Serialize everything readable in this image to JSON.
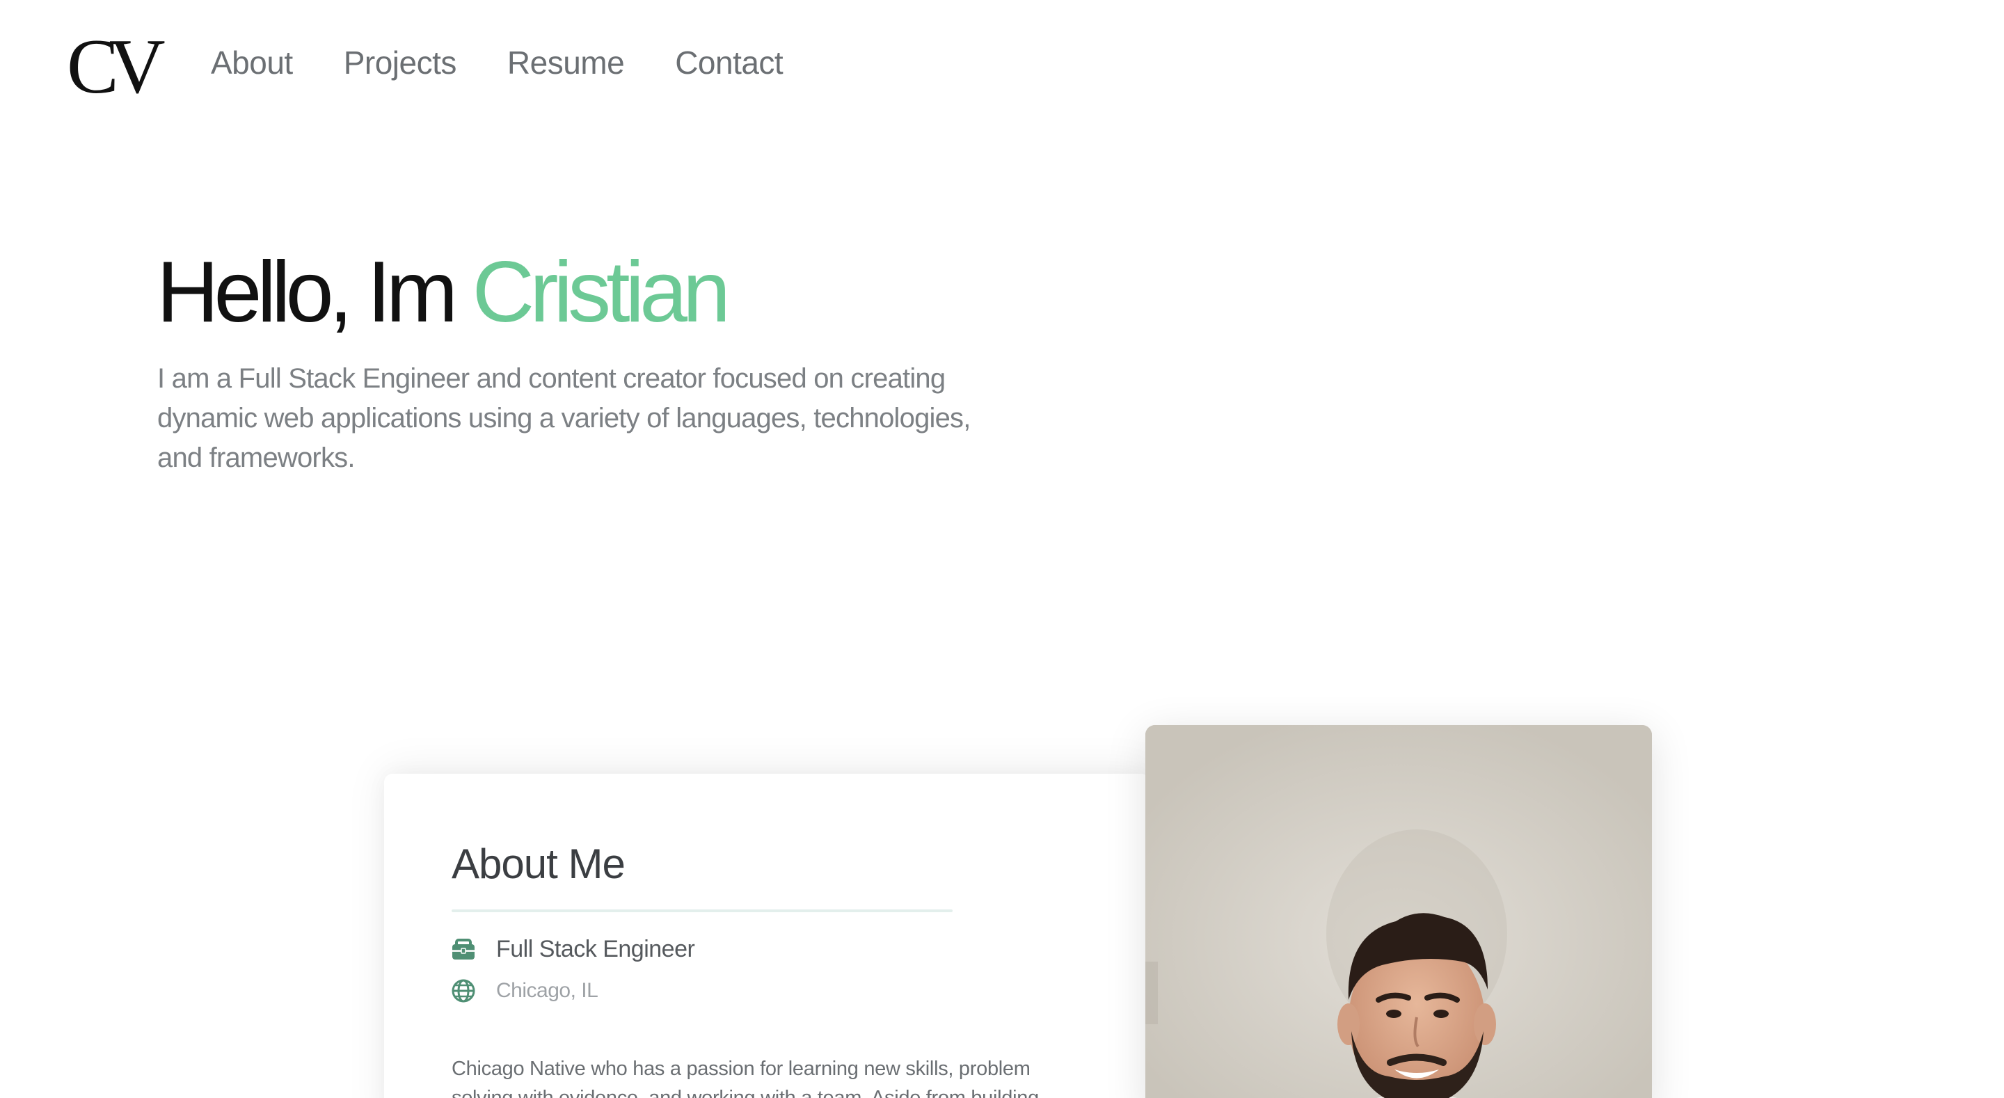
{
  "nav": {
    "logo": "CV",
    "links": [
      "About",
      "Projects",
      "Resume",
      "Contact"
    ]
  },
  "hero": {
    "greeting": "Hello, Im ",
    "name": "Cristian",
    "description": "I am a Full Stack Engineer and content creator focused on creating dynamic web applications using a variety of languages, technologies, and frameworks."
  },
  "about": {
    "title": "About Me",
    "job_icon": "briefcase-icon",
    "job": "Full Stack Engineer",
    "location_icon": "globe-icon",
    "location": "Chicago, IL",
    "bio": "Chicago Native who has a passion for learning new skills, problem solving with evidence, and working with a team. Aside from building"
  },
  "colors": {
    "accent": "#6cc995",
    "icon": "#4f8f74",
    "text_muted": "#7c8084"
  }
}
